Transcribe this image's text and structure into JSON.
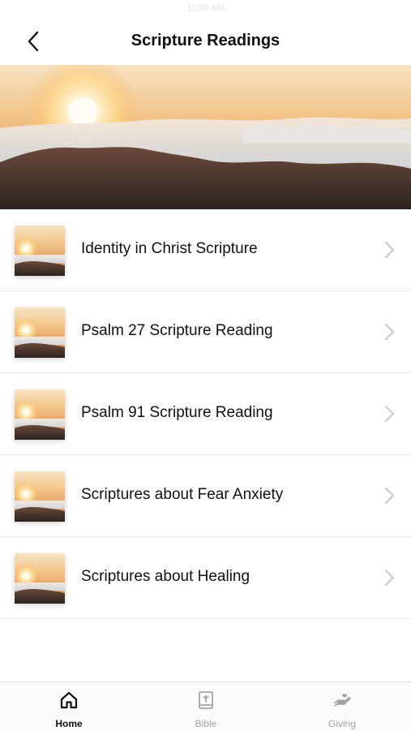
{
  "status_bar": {
    "text": "11:00 AM"
  },
  "header": {
    "title": "Scripture Readings",
    "back_icon": "chevron-left-icon"
  },
  "hero": {
    "image": "sunrise-over-clouds-mountains"
  },
  "readings": [
    {
      "label": "Identity in Christ Scripture",
      "thumbnail": "sunrise-thumbnail"
    },
    {
      "label": "Psalm 27 Scripture Reading",
      "thumbnail": "sunrise-thumbnail"
    },
    {
      "label": "Psalm 91 Scripture Reading",
      "thumbnail": "sunrise-thumbnail"
    },
    {
      "label": "Scriptures about Fear Anxiety",
      "thumbnail": "sunrise-thumbnail"
    },
    {
      "label": "Scriptures about Healing",
      "thumbnail": "sunrise-thumbnail"
    }
  ],
  "tab_bar": {
    "tabs": [
      {
        "label": "Home",
        "icon": "home-icon",
        "active": true
      },
      {
        "label": "Bible",
        "icon": "bible-icon",
        "active": false
      },
      {
        "label": "Giving",
        "icon": "giving-hand-icon",
        "active": false
      }
    ]
  },
  "colors": {
    "active_tab": "#111111",
    "inactive_tab": "#a3a3a3",
    "divider": "#e9e9e9",
    "chevron": "#c7c7cc"
  }
}
